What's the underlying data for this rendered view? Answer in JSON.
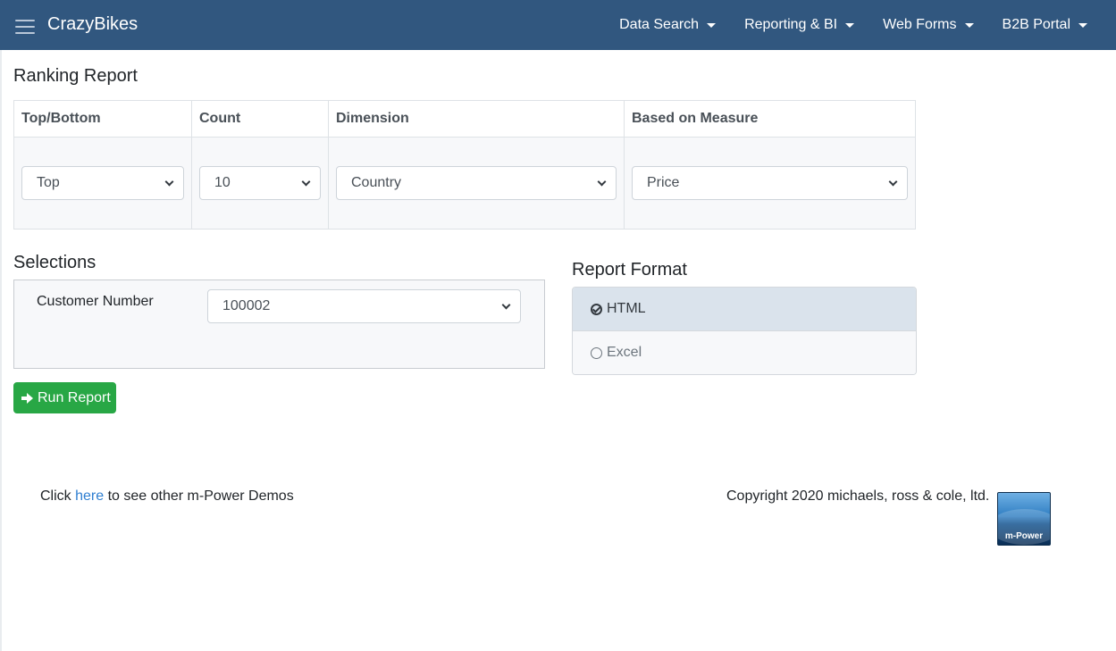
{
  "navbar": {
    "brand": "CrazyBikes",
    "menu": [
      {
        "label": "Data Search"
      },
      {
        "label": "Reporting & BI"
      },
      {
        "label": "Web Forms"
      },
      {
        "label": "B2B Portal"
      }
    ]
  },
  "ranking": {
    "title": "Ranking Report",
    "headers": [
      "Top/Bottom",
      "Count",
      "Dimension",
      "Based on Measure"
    ],
    "selects": {
      "top_bottom": "Top",
      "count": "10",
      "dimension": "Country",
      "measure": "Price"
    }
  },
  "selections": {
    "title": "Selections",
    "customer_label": "Customer Number",
    "customer_value": "100002"
  },
  "report_format": {
    "title": "Report Format",
    "options": [
      {
        "label": "HTML",
        "selected": true
      },
      {
        "label": "Excel",
        "selected": false
      }
    ]
  },
  "run_button": "Run Report",
  "footer": {
    "prefix": "Click",
    "link": "here",
    "suffix": "to see other m-Power Demos",
    "copyright": "Copyright 2020 michaels, ross & cole, ltd.",
    "logo_text": "m-Power"
  },
  "colors": {
    "navbar": "#31577f",
    "run_button": "#28a745",
    "link": "#2f7fd1"
  }
}
